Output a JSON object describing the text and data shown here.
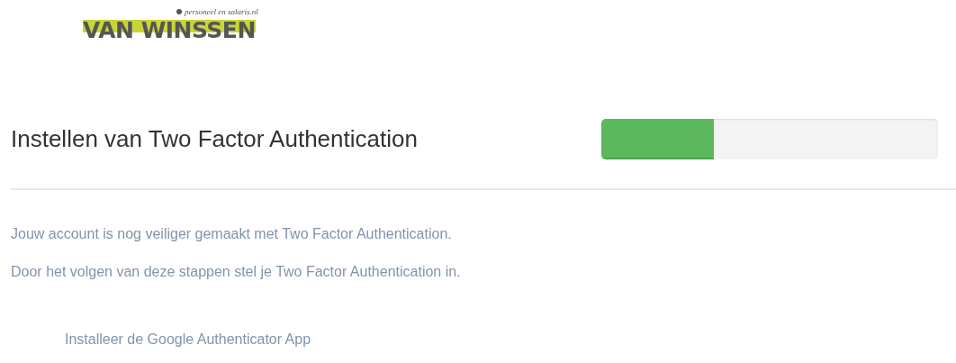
{
  "logo": {
    "name": "VAN WINSSEN",
    "tagline": "personeel en salaris.nl"
  },
  "header": {
    "title": "Instellen van Two Factor Authentication",
    "progress": {
      "level": 0.333
    }
  },
  "paragraphs": [
    "Jouw account is nog veiliger gemaakt met Two Factor Authentication.",
    "Door het volgen van deze stappen stel je Two Factor Authentication in."
  ],
  "steps": [
    "Installeer de Google Authenticator App"
  ]
}
